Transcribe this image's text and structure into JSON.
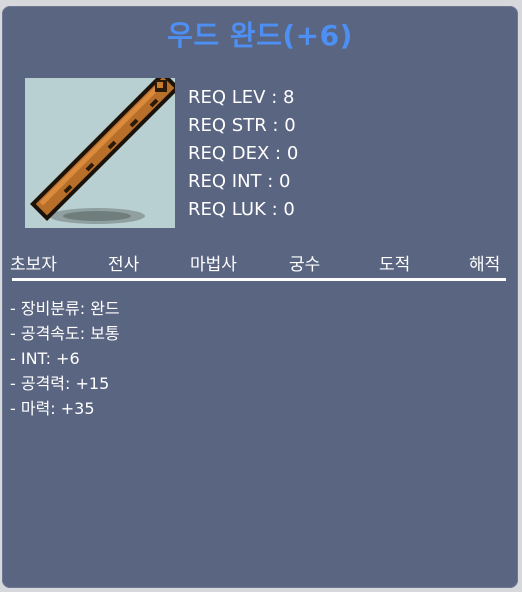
{
  "item": {
    "name": "우드 완드(+6)",
    "icon": "wooden-wand-icon"
  },
  "requirements": [
    "REQ LEV : 8",
    "REQ STR : 0",
    "REQ DEX : 0",
    "REQ INT : 0",
    "REQ LUK : 0"
  ],
  "jobs": [
    "초보자",
    "전사",
    "마법사",
    "궁수",
    "도적",
    "해적"
  ],
  "stats": [
    "- 장비분류: 완드",
    "- 공격속도: 보통",
    "- INT: +6",
    "- 공격력: +15",
    "- 마력: +35"
  ],
  "colors": {
    "panel": "#5a6581",
    "title": "#4d8ff2",
    "icon_bg": "#b9d0d2"
  }
}
